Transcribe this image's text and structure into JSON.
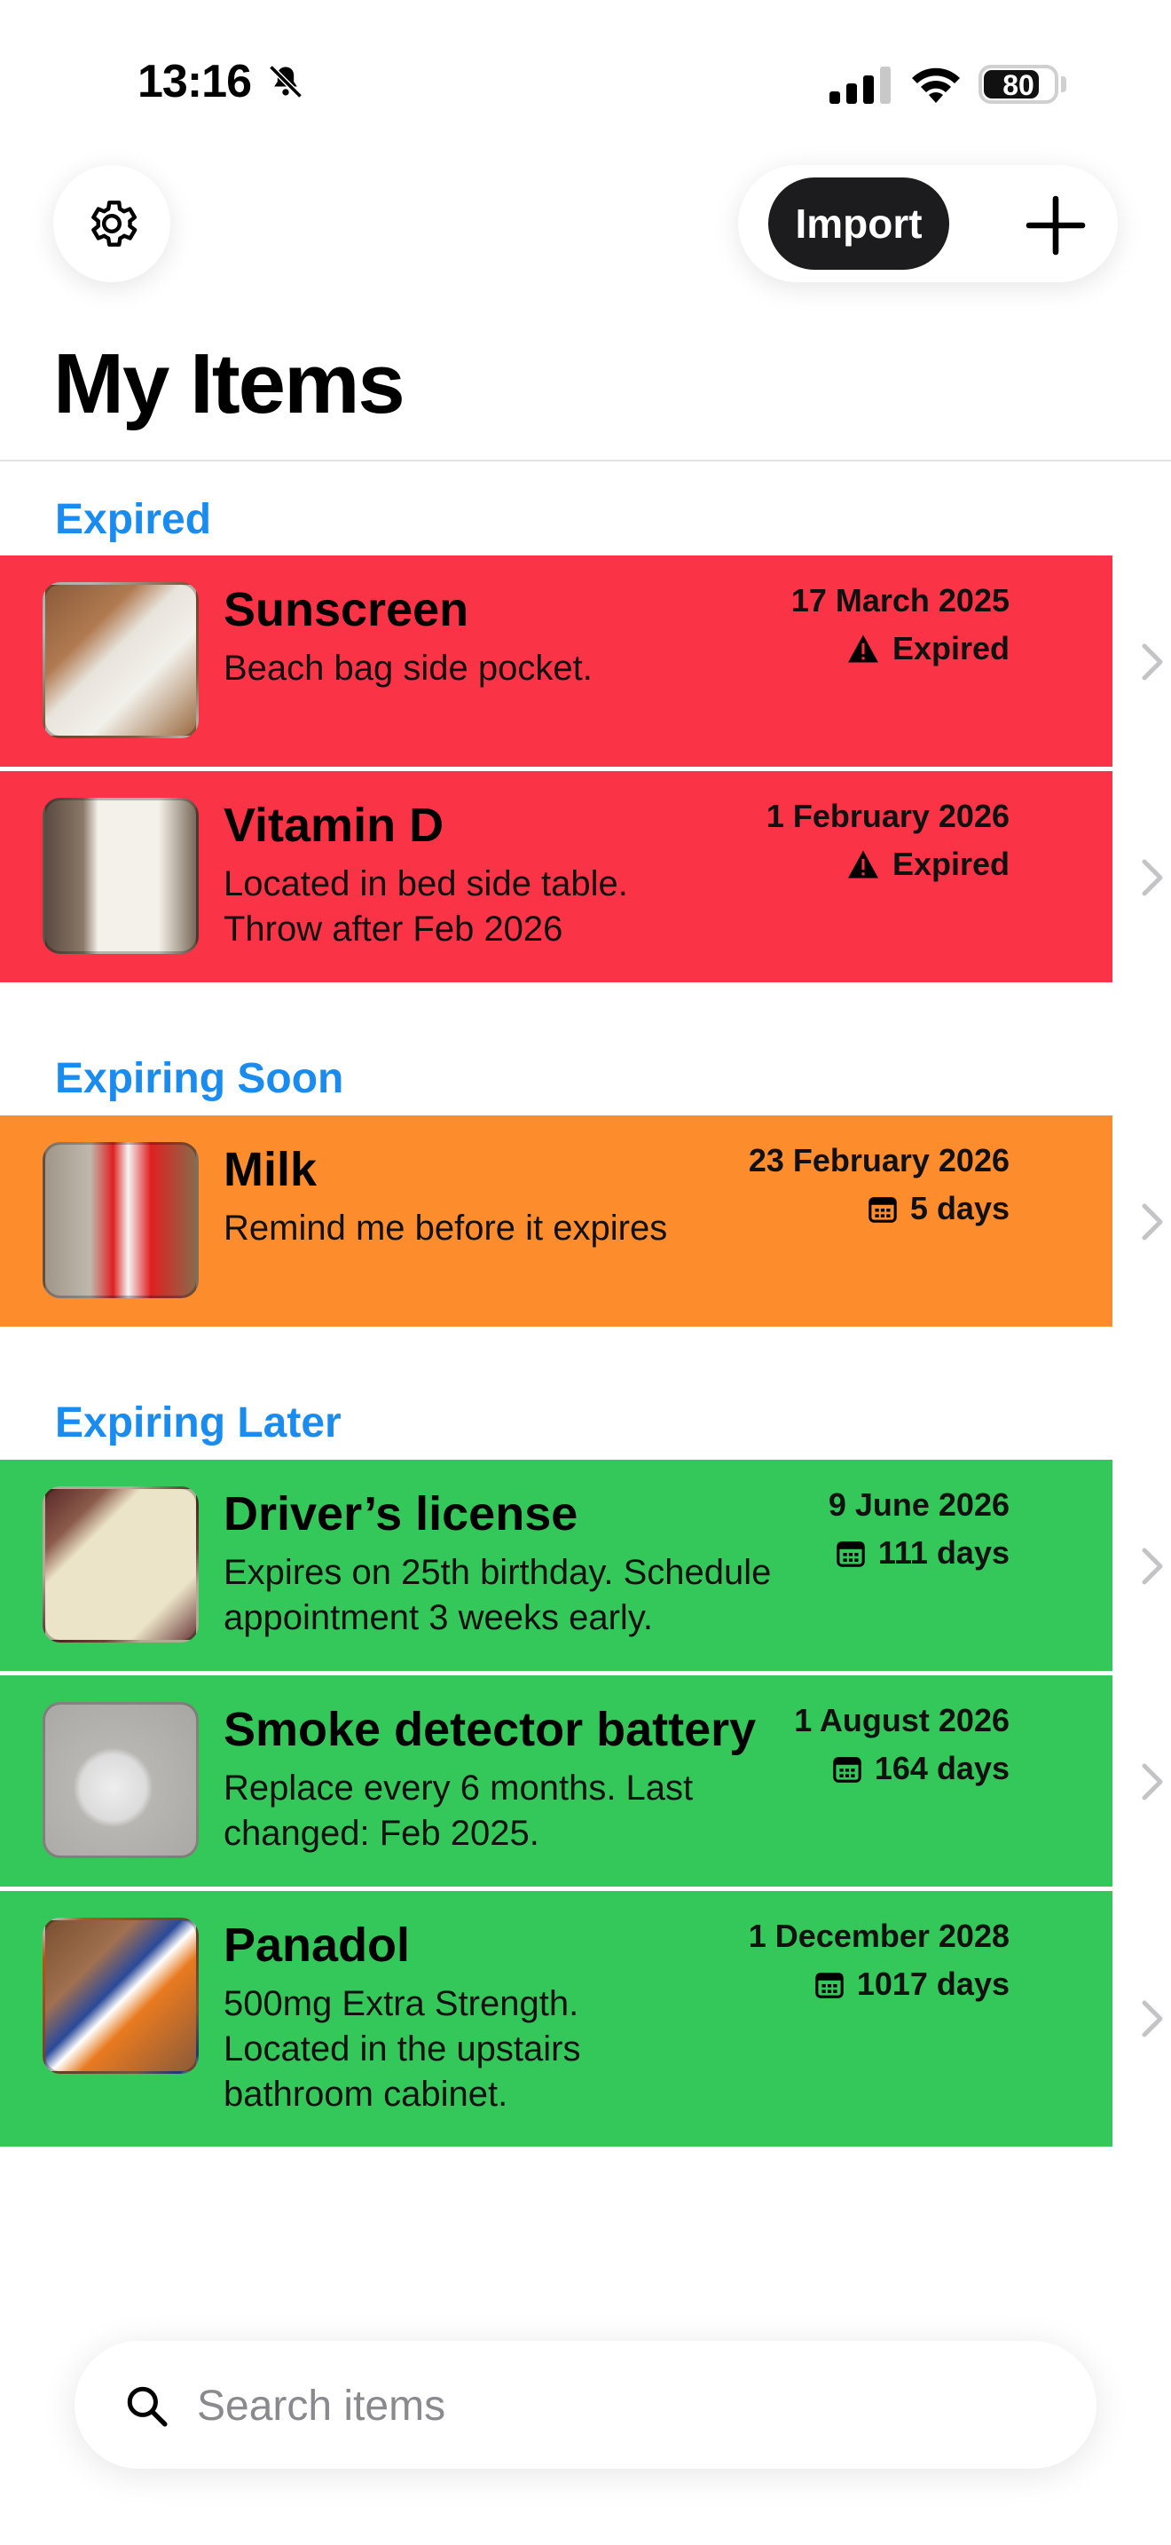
{
  "status_bar": {
    "time": "13:16",
    "battery": "80",
    "battery_level": 0.8
  },
  "toolbar": {
    "import_label": "Import",
    "settings_icon": "gear-icon",
    "add_icon": "plus-icon"
  },
  "page_title": "My Items",
  "sections": [
    {
      "title": "Expired",
      "color": "#fa3446",
      "items": [
        {
          "title": "Sunscreen",
          "note": [
            "Beach bag side pocket."
          ],
          "date": "17 March 2025",
          "status": "Expired",
          "status_icon": "warning-icon"
        },
        {
          "title": "Vitamin D",
          "note": [
            "Located in bed side table.",
            "Throw after Feb 2026"
          ],
          "date": "1 February 2026",
          "status": "Expired",
          "status_icon": "warning-icon"
        }
      ]
    },
    {
      "title": "Expiring Soon",
      "color": "#fd8c2c",
      "items": [
        {
          "title": "Milk",
          "note": [
            "Remind me before it expires"
          ],
          "date": "23 February 2026",
          "status": "5 days",
          "status_icon": "calendar-icon"
        }
      ]
    },
    {
      "title": "Expiring Later",
      "color": "#34c759",
      "items": [
        {
          "title": "Driver’s license",
          "note": [
            "Expires on 25th birthday. Schedule",
            "appointment 3 weeks early."
          ],
          "date": "9 June 2026",
          "status": "111 days",
          "status_icon": "calendar-icon"
        },
        {
          "title": "Smoke detector battery",
          "note": [
            "Replace every 6 months. Last",
            "changed: Feb 2025."
          ],
          "date": "1 August 2026",
          "status": "164 days",
          "status_icon": "calendar-icon"
        },
        {
          "title": "Panadol",
          "note": [
            "500mg Extra Strength.",
            "Located in the upstairs",
            "bathroom cabinet."
          ],
          "date": "1 December 2028",
          "status": "1017 days",
          "status_icon": "calendar-icon"
        }
      ]
    }
  ],
  "search": {
    "placeholder": "Search items"
  }
}
